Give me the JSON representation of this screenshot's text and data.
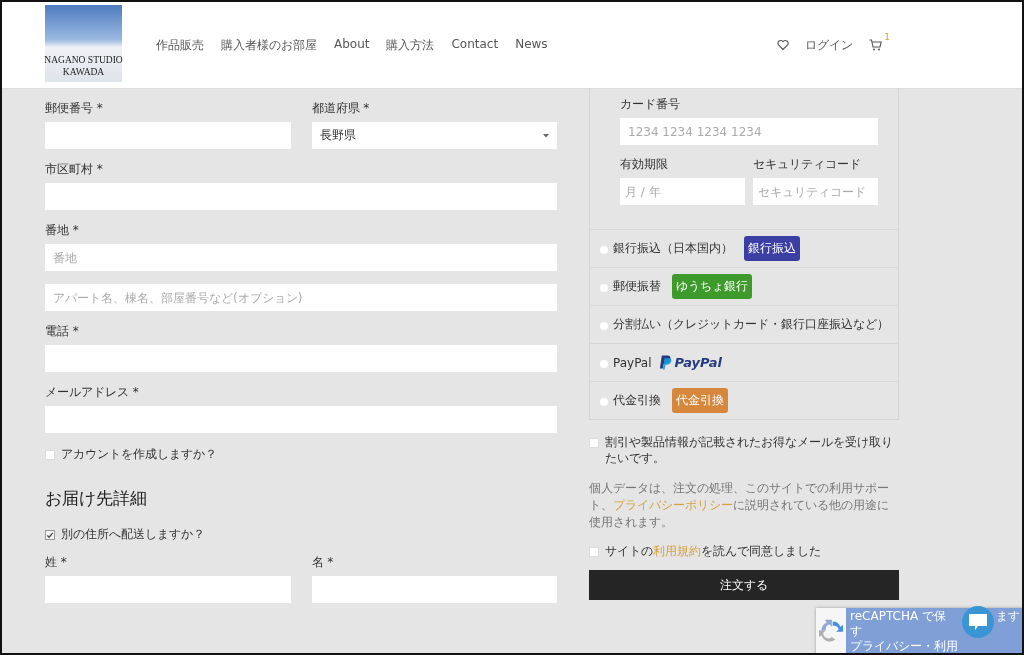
{
  "header": {
    "logo": {
      "line1": "NAGANO STUDIO",
      "line2": "KAWADA"
    },
    "nav": [
      "作品販売",
      "購入者様のお部屋",
      "About",
      "購入方法",
      "Contact",
      "News"
    ],
    "login": "ログイン",
    "cart_count": "1"
  },
  "billing": [
    {
      "kind": "row",
      "fields": [
        {
          "kind": "text",
          "label": "郵便番号 *"
        },
        {
          "kind": "select",
          "label": "都道府県 *",
          "value": "長野県"
        }
      ]
    },
    {
      "kind": "row",
      "fields": [
        {
          "kind": "text",
          "label": "市区町村 *"
        }
      ]
    },
    {
      "kind": "row",
      "fields": [
        {
          "kind": "text",
          "label": "番地 *",
          "placeholder": "番地"
        }
      ]
    },
    {
      "kind": "row",
      "fields": [
        {
          "kind": "text",
          "placeholder": "アパート名、棟名、部屋番号など(オプション)"
        }
      ]
    },
    {
      "kind": "row",
      "fields": [
        {
          "kind": "text",
          "label": "電話 *"
        }
      ]
    },
    {
      "kind": "row",
      "fields": [
        {
          "kind": "text",
          "label": "メールアドレス *"
        }
      ]
    },
    {
      "kind": "checkbox",
      "label": "アカウントを作成しますか？",
      "checked": false
    },
    {
      "kind": "heading",
      "text": "お届け先詳細"
    },
    {
      "kind": "checkbox",
      "label": "別の住所へ配送しますか？",
      "checked": true
    },
    {
      "kind": "row",
      "fields": [
        {
          "kind": "text",
          "label": "姓 *"
        },
        {
          "kind": "text",
          "label": "名 *"
        }
      ]
    }
  ],
  "card": {
    "number_label": "カード番号",
    "number_placeholder": "1234 1234 1234 1234",
    "expiry_label": "有効期限",
    "expiry_placeholder": "月 / 年",
    "cvc_label": "セキュリティコード",
    "cvc_placeholder": "セキュリティコード"
  },
  "payment_methods": [
    {
      "label": "銀行振込（日本国内）",
      "selected": false,
      "kind": "badge",
      "badge": "銀行振込",
      "color": "#3b3ea3"
    },
    {
      "label": "郵便振替",
      "selected": false,
      "kind": "badge",
      "badge": "ゆうちょ銀行",
      "color": "#3d9a2b"
    },
    {
      "label": "分割払い（クレジットカード・銀行口座振込など）",
      "selected": false,
      "kind": "plain"
    },
    {
      "label": "PayPal",
      "selected": false,
      "kind": "paypal",
      "logo": "PayPal"
    },
    {
      "label": "代金引換",
      "selected": false,
      "kind": "badge",
      "badge": "代金引換",
      "color": "#d7873c"
    }
  ],
  "newsletter": {
    "label": "割引や製品情報が記載されたお得なメールを受け取りたいです。",
    "checked": false
  },
  "privacy": {
    "before": "個人データは、注文の処理、このサイトでの利用サポート、",
    "link": "プライバシーポリシー",
    "after": "に説明されている他の用途に使用されます。"
  },
  "terms": {
    "before": "サイトの",
    "link": "利用規約",
    "after": "を読んで同意しました",
    "checked": false
  },
  "place_order": "注文する",
  "recaptcha": {
    "line1": "reCAPTCHA で保",
    "line1_end": "ます",
    "line2": "す",
    "line3": "プライバシー・利用"
  }
}
